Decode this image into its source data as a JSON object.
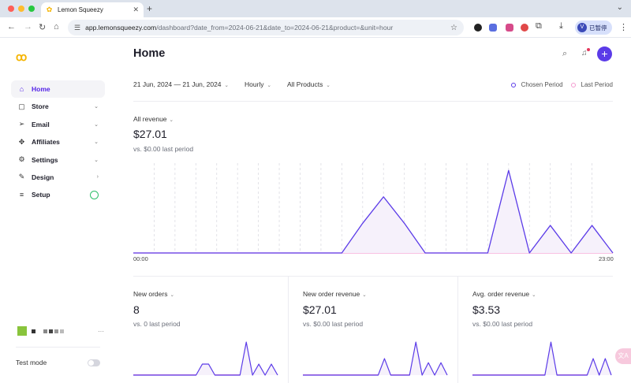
{
  "browser": {
    "tab_title": "Lemon Squeezy",
    "url_host": "app.lemonsqueezy.com",
    "url_path": "/dashboard?date_from=2024-06-21&date_to=2024-06-21&product=&unit=hour",
    "profile_initial": "V",
    "profile_name": "已暂停"
  },
  "sidebar": {
    "items": [
      {
        "label": "Home",
        "icon": "home-icon"
      },
      {
        "label": "Store",
        "icon": "store-icon"
      },
      {
        "label": "Email",
        "icon": "send-icon"
      },
      {
        "label": "Affiliates",
        "icon": "affiliates-icon"
      },
      {
        "label": "Settings",
        "icon": "gear-icon"
      },
      {
        "label": "Design",
        "icon": "design-icon"
      },
      {
        "label": "Setup",
        "icon": "sliders-icon"
      }
    ],
    "store_more": "···",
    "test_mode_label": "Test mode"
  },
  "header": {
    "title": "Home"
  },
  "filters": {
    "date_range": "21 Jun, 2024  —  21 Jun, 2024",
    "granularity": "Hourly",
    "products": "All Products"
  },
  "legend": {
    "chosen": "Chosen Period",
    "last": "Last Period"
  },
  "colors": {
    "accent": "#5b3be8",
    "last_period": "#f39bd0",
    "setup_ring": "#2fbf6a"
  },
  "main_metric": {
    "label": "All revenue",
    "value": "$27.01",
    "compare": "vs. $0.00 last period"
  },
  "metrics": [
    {
      "label": "New orders",
      "value": "8",
      "compare": "vs. 0 last period"
    },
    {
      "label": "New order revenue",
      "value": "$27.01",
      "compare": "vs. $0.00 last period"
    },
    {
      "label": "Avg. order revenue",
      "value": "$3.53",
      "compare": "vs. $0.00 last period"
    }
  ],
  "chart_data": [
    {
      "type": "area",
      "x_start_label": "00:00",
      "x_end_label": "23:00",
      "series": [
        {
          "name": "Chosen Period",
          "values": [
            0,
            0,
            0,
            0,
            0,
            0,
            0,
            0,
            0,
            0,
            0,
            2.7,
            5.1,
            2.7,
            0,
            0,
            0,
            0,
            7.5,
            0,
            2.5,
            0,
            2.5,
            0
          ]
        },
        {
          "name": "Last Period",
          "values": [
            0,
            0,
            0,
            0,
            0,
            0,
            0,
            0,
            0,
            0,
            0,
            0,
            0,
            0,
            0,
            0,
            0,
            0,
            0,
            0,
            0,
            0,
            0,
            0
          ]
        }
      ]
    },
    {
      "type": "line",
      "values": [
        0,
        0,
        0,
        0,
        0,
        0,
        0,
        0,
        0,
        0,
        0,
        1,
        1,
        0,
        0,
        0,
        0,
        0,
        3,
        0,
        1,
        0,
        1,
        0
      ]
    },
    {
      "type": "line",
      "values": [
        0,
        0,
        0,
        0,
        0,
        0,
        0,
        0,
        0,
        0,
        0,
        0,
        0,
        1.6,
        0,
        0,
        0,
        0,
        3.2,
        0,
        1.2,
        0,
        1.2,
        0
      ]
    },
    {
      "type": "line",
      "values": [
        0,
        0,
        0,
        0,
        0,
        0,
        0,
        0,
        0,
        0,
        0,
        0,
        0,
        1.6,
        0,
        0,
        0,
        0,
        0,
        0,
        0.8,
        0,
        0.8,
        0
      ]
    }
  ]
}
